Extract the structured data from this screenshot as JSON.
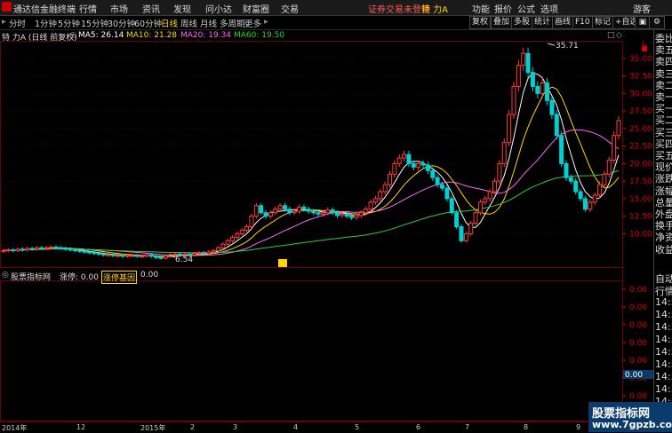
{
  "menubar": {
    "app_title": "通达信金融终端",
    "items": [
      "行情",
      "市场",
      "资讯",
      "发现",
      "问小达",
      "财富圈",
      "交易"
    ],
    "status": "证券交易未登录",
    "stock_name": "特 力A",
    "right_items": [
      "功能",
      "报价",
      "公式",
      "选项"
    ],
    "guest": "游客"
  },
  "toolbar": {
    "periods": [
      "分时",
      "1分钟",
      "5分钟",
      "15分钟",
      "30分钟",
      "60分钟",
      "日线",
      "周线",
      "月线",
      "多周期",
      "更多"
    ],
    "active_period": "日线",
    "buttons": [
      "复权",
      "叠加",
      "多股",
      "统计",
      "画线",
      "F10",
      "标记",
      "+自选"
    ]
  },
  "infobar": {
    "title": "特 力A (日线 前复权)",
    "ma5": "MA5: 26.14",
    "ma10": "MA10: 21.28",
    "ma20": "MA20: 19.34",
    "ma60": "MA60: 19.50"
  },
  "colors": {
    "ma5": "#ffffff",
    "ma10": "#ffd700",
    "ma20": "#ff66ff",
    "ma60": "#33cc33",
    "up": "#ff3b3b",
    "down": "#00d0d0"
  },
  "price_axis": {
    "labels": [
      "35.00",
      "32.50",
      "30.00",
      "27.50",
      "25.00",
      "22.50",
      "20.00",
      "17.50",
      "15.00",
      "12.50",
      "10.00"
    ],
    "high_marker": "35.71",
    "low_marker": "6.54",
    "unit": "L"
  },
  "lower_axis": {
    "labels": [
      "0.00",
      "0.00",
      "0.00",
      "0.00",
      "0.00",
      "0.00",
      "0.00",
      "0.00"
    ],
    "highlight": "0.00"
  },
  "indicator_bar": {
    "name": "股票指标网",
    "field1": "涨停: 0.00",
    "field2": "涨停基因",
    "field2_value": "0.00"
  },
  "xaxis": {
    "labels": [
      "2014年",
      "12",
      "2015年",
      "2",
      "3",
      "4",
      "5",
      "6",
      "7",
      "8",
      "9"
    ]
  },
  "right_panel": {
    "top": [
      "委比",
      "卖五",
      "卖四",
      "卖三",
      "卖二",
      "卖一",
      "买一",
      "买二",
      "买三",
      "买四",
      "买五",
      "现价",
      "涨跌",
      "涨幅",
      "总量",
      "外盘",
      "换手",
      "净资",
      "收益"
    ],
    "bottom": [
      "自动",
      "行情",
      "14:5",
      "14:5",
      "14:5",
      "14:5",
      "14:5",
      "14:5",
      "14:5",
      "14:5",
      "14:5"
    ]
  },
  "watermark": {
    "line1": "股票指标网",
    "line2": "www.7gpzb.com"
  },
  "chart_data": {
    "type": "candlestick",
    "y_range": [
      5.5,
      37
    ],
    "x_labels": [
      "2014年",
      "12",
      "2015年",
      "2",
      "3",
      "4",
      "5",
      "6",
      "7",
      "8",
      "9"
    ],
    "ma_names": [
      "MA5",
      "MA10",
      "MA20",
      "MA60"
    ],
    "closes": [
      7.6,
      7.7,
      7.6,
      7.8,
      7.7,
      7.9,
      7.8,
      8.0,
      7.9,
      8.0,
      8.1,
      8.0,
      7.9,
      7.8,
      7.7,
      7.6,
      7.5,
      7.4,
      7.3,
      7.2,
      7.1,
      7.0,
      7.0,
      6.9,
      6.9,
      6.8,
      6.9,
      6.9,
      6.8,
      6.8,
      7.0,
      6.8,
      6.6,
      6.54,
      6.8,
      7.0,
      7.1,
      7.0,
      7.1,
      7.0,
      7.2,
      7.3,
      7.2,
      7.4,
      7.6,
      8.0,
      8.5,
      9.0,
      9.5,
      10.0,
      10.5,
      11.0,
      12.5,
      14.0,
      13.0,
      12.5,
      13.0,
      13.5,
      14.0,
      13.5,
      13.0,
      13.2,
      13.8,
      13.5,
      13.2,
      13.0,
      12.8,
      13.0,
      13.4,
      13.0,
      12.6,
      12.8,
      12.5,
      12.3,
      12.6,
      13.0,
      13.5,
      14.5,
      15.0,
      16.0,
      17.0,
      18.5,
      20.0,
      20.8,
      21.3,
      20.0,
      19.5,
      20.0,
      19.8,
      19.0,
      18.0,
      17.0,
      16.5,
      15.0,
      13.0,
      11.0,
      9.0,
      10.0,
      11.5,
      13.0,
      14.5,
      15.0,
      16.0,
      17.5,
      20.0,
      23.0,
      27.0,
      31.0,
      34.0,
      35.71,
      33.0,
      31.0,
      30.0,
      31.5,
      29.0,
      27.0,
      24.0,
      20.0,
      18.0,
      17.5,
      16.0,
      15.0,
      13.5,
      14.5,
      15.5,
      17.0,
      18.5,
      20.5,
      24.0,
      26.14
    ]
  }
}
